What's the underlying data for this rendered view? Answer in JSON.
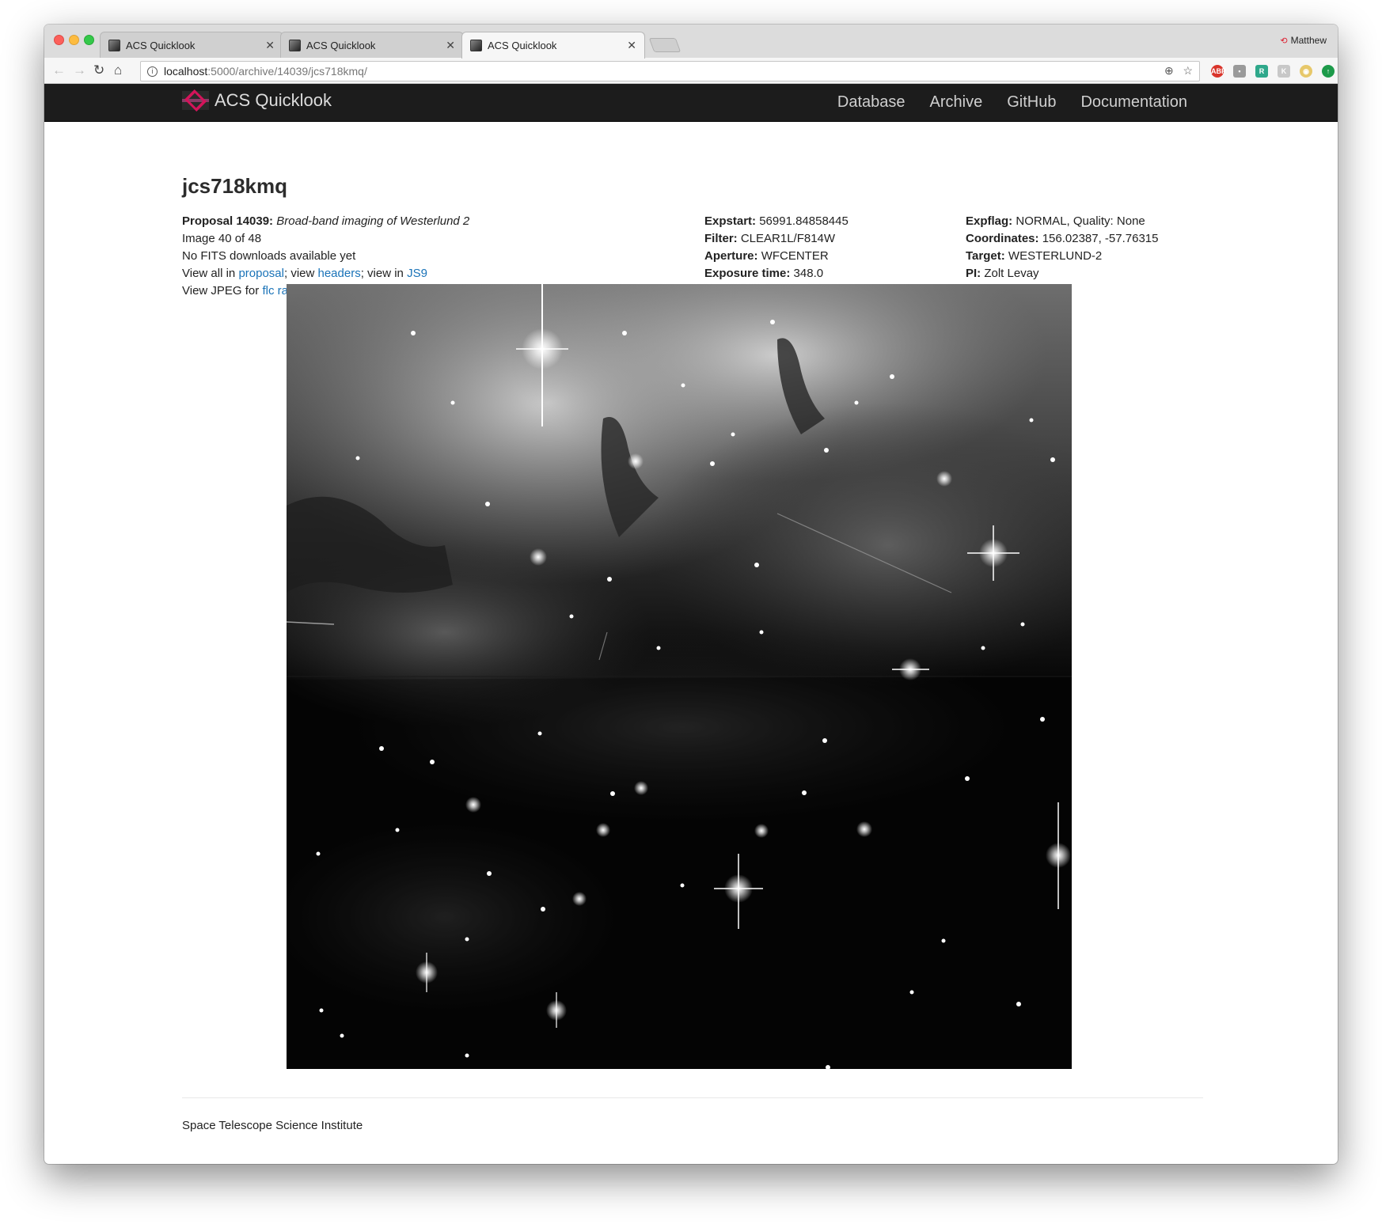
{
  "browser": {
    "tabs": [
      {
        "title": "ACS Quicklook",
        "active": false
      },
      {
        "title": "ACS Quicklook",
        "active": false
      },
      {
        "title": "ACS Quicklook",
        "active": true
      }
    ],
    "profile_name": "Matthew",
    "url_host": "localhost",
    "url_path": ":5000/archive/14039/jcs718kmq/",
    "extensions": [
      "adblock-icon",
      "pocket-icon",
      "r-extension-icon",
      "k-extension-icon",
      "owl-extension-icon",
      "green-up-icon"
    ]
  },
  "navbar": {
    "brand": "ACS Quicklook",
    "links": [
      "Database",
      "Archive",
      "GitHub",
      "Documentation"
    ]
  },
  "page": {
    "title": "jcs718kmq",
    "col1": {
      "proposal_label": "Proposal 14039:",
      "proposal_title": "Broad-band imaging of Westerlund 2",
      "image_index": "Image 40 of 48",
      "fits_note": "No FITS downloads available yet",
      "view_all_prefix": "View all in ",
      "proposal_link": "proposal",
      "view_sep1": "; view ",
      "headers_link": "headers",
      "view_sep2": "; view in ",
      "js9_link": "JS9",
      "jpeg_prefix": "View JPEG for ",
      "flc_link": "flc",
      "raw_link": "raw"
    },
    "col2": [
      {
        "label": "Expstart:",
        "value": "56991.84858445"
      },
      {
        "label": "Filter:",
        "value": "CLEAR1L/F814W"
      },
      {
        "label": "Aperture:",
        "value": "WFCENTER"
      },
      {
        "label": "Exposure time:",
        "value": "348.0"
      }
    ],
    "col3": [
      {
        "label": "Expflag:",
        "value": "NORMAL, Quality: None"
      },
      {
        "label": "Coordinates:",
        "value": "156.02387, -57.76315"
      },
      {
        "label": "Target:",
        "value": "WESTERLUND-2"
      },
      {
        "label": "PI:",
        "value": "Zolt Levay"
      }
    ]
  },
  "footer": {
    "text": "Space Telescope Science Institute"
  }
}
